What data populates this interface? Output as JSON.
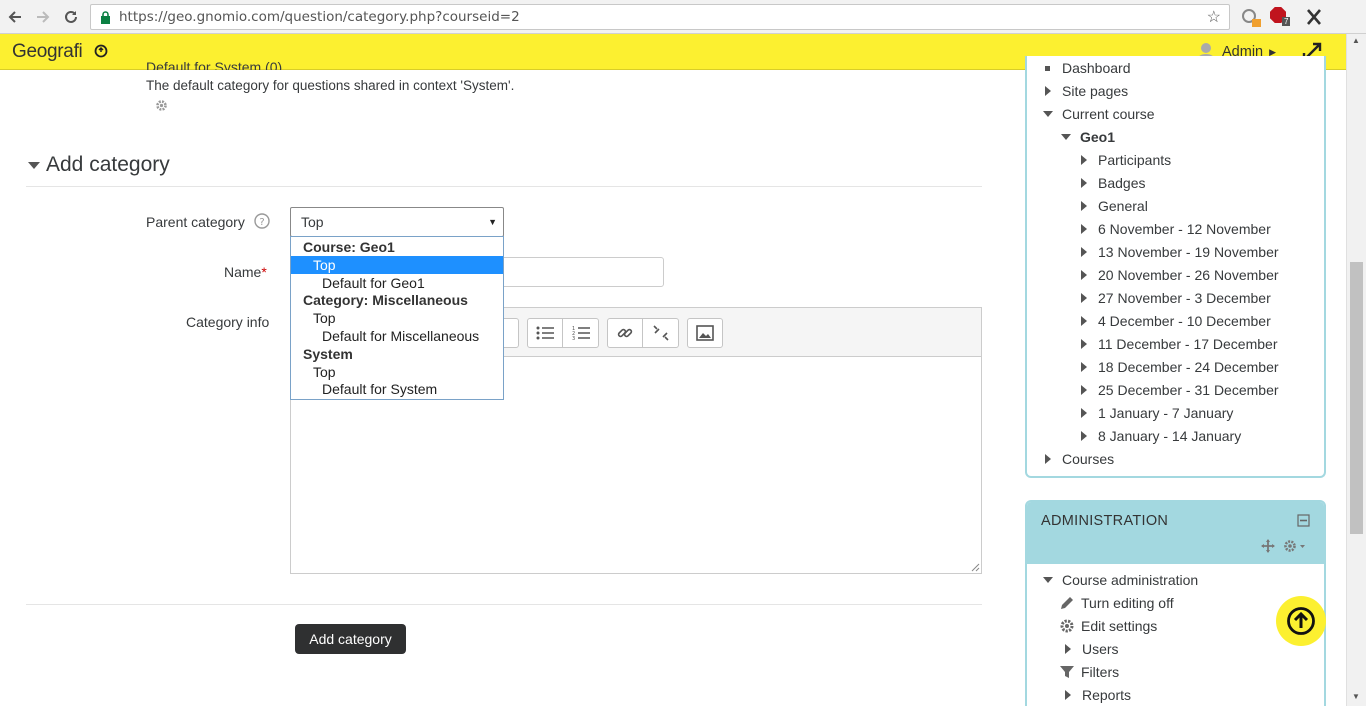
{
  "browser": {
    "url": "https://geo.gnomio.com/question/category.php?courseid=2",
    "abp_badge": "7"
  },
  "navbar": {
    "brand": "Geografi",
    "user": "Admin"
  },
  "content": {
    "cut_text": "Default for System (0)",
    "description": "The default category for questions shared in context 'System'.",
    "section_title": "Add category",
    "parent_label": "Parent category",
    "name_label": "Name",
    "required_mark": "*",
    "info_label": "Category info",
    "select_value": "Top",
    "submit": "Add category"
  },
  "dropdown": {
    "options": [
      {
        "label": "Course: Geo1",
        "kind": "group"
      },
      {
        "label": "Top",
        "kind": "l1",
        "selected": true
      },
      {
        "label": "Default for Geo1",
        "kind": "l2"
      },
      {
        "label": "Category: Miscellaneous",
        "kind": "group"
      },
      {
        "label": "Top",
        "kind": "l1"
      },
      {
        "label": "Default for Miscellaneous",
        "kind": "l2"
      },
      {
        "label": "System",
        "kind": "group"
      },
      {
        "label": "Top",
        "kind": "l1"
      },
      {
        "label": "Default for System",
        "kind": "l2"
      }
    ]
  },
  "navigation": {
    "dashboard": "Dashboard",
    "site_pages": "Site pages",
    "current_course": "Current course",
    "course": "Geo1",
    "items": [
      "Participants",
      "Badges",
      "General",
      "6 November - 12 November",
      "13 November - 19 November",
      "20 November - 26 November",
      "27 November - 3 December",
      "4 December - 10 December",
      "11 December - 17 December",
      "18 December - 24 December",
      "25 December - 31 December",
      "1 January - 7 January",
      "8 January - 14 January"
    ],
    "courses": "Courses"
  },
  "administration": {
    "title": "ADMINISTRATION",
    "course_admin": "Course administration",
    "items": [
      {
        "label": "Turn editing off",
        "icon": "pencil-icon"
      },
      {
        "label": "Edit settings",
        "icon": "gear-icon"
      },
      {
        "label": "Users",
        "icon": "triangle"
      },
      {
        "label": "Filters",
        "icon": "filter-icon"
      },
      {
        "label": "Reports",
        "icon": "triangle"
      }
    ]
  }
}
